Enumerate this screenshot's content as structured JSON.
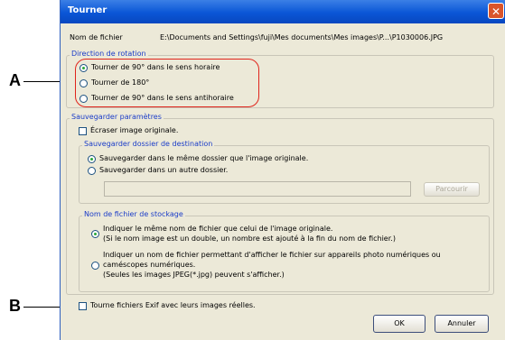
{
  "dialog": {
    "title": "Tourner",
    "close_glyph": "✕",
    "filename_label": "Nom de fichier",
    "filename_value": "E:\\Documents and Settings\\fuji\\Mes documents\\Mes images\\P...\\P1030006.JPG"
  },
  "rotation": {
    "legend": "Direction de rotation",
    "options": [
      {
        "label": "Tourner de 90° dans le sens horaire",
        "selected": true
      },
      {
        "label": "Tourner de 180°",
        "selected": false
      },
      {
        "label": "Tourner de 90° dans le sens antihoraire",
        "selected": false
      }
    ]
  },
  "save_settings": {
    "legend": "Sauvegarder paramètres",
    "overwrite_label": "Écraser image originale.",
    "overwrite_checked": false,
    "destination": {
      "legend": "Sauvegarder dossier de destination",
      "options": [
        {
          "label": "Sauvegarder dans le même dossier que l'image originale.",
          "selected": true
        },
        {
          "label": "Sauvegarder dans un autre dossier.",
          "selected": false
        }
      ],
      "path_value": "",
      "browse_label": "Parcourir"
    },
    "storage_name": {
      "legend": "Nom de fichier de stockage",
      "option1_line1": "Indiquer le même nom de fichier que celui de l'image originale.",
      "option1_line2": "(Si le nom image est un double, un nombre est ajouté à la fin du nom de fichier.)",
      "option2_line1": "Indiquer un nom de fichier permettant d'afficher le fichier sur appareils photo numériques ou",
      "option2_line2": "caméscopes numériques.",
      "option2_line3": "(Seules les images JPEG(*.jpg) peuvent s'afficher.)",
      "option1_selected": true,
      "option2_selected": false
    }
  },
  "exif": {
    "label": "Tourne fichiers Exif avec leurs images réelles.",
    "checked": false
  },
  "buttons": {
    "ok": "OK",
    "cancel": "Annuler"
  },
  "callouts": {
    "a": "A",
    "b": "B"
  },
  "colors": {
    "accent_oval": "#e0241b",
    "titlebar": "#0a56d6",
    "legend_text": "#1a3cc8",
    "dialog_bg": "#ece9d8"
  }
}
